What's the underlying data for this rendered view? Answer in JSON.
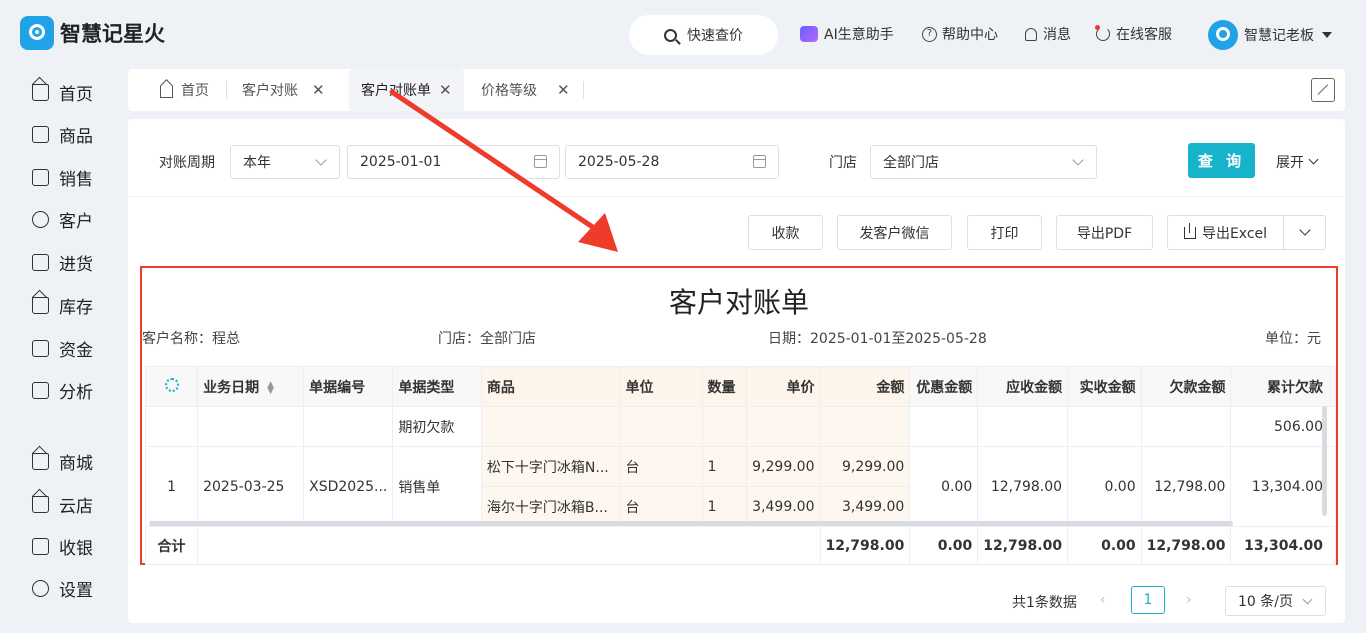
{
  "app": {
    "name": "智慧记星火"
  },
  "header": {
    "quick_search": "快速查价",
    "ai_assistant": "AI生意助手",
    "help_center": "帮助中心",
    "messages": "消息",
    "online_service": "在线客服",
    "user_name": "智慧记老板"
  },
  "sidebar": {
    "items": [
      {
        "label": "首页",
        "icon": "home-icon"
      },
      {
        "label": "商品",
        "icon": "bag-icon"
      },
      {
        "label": "销售",
        "icon": "clipboard-icon"
      },
      {
        "label": "客户",
        "icon": "user-icon"
      },
      {
        "label": "进货",
        "icon": "book-icon"
      },
      {
        "label": "库存",
        "icon": "warehouse-icon"
      },
      {
        "label": "资金",
        "icon": "wallet-icon"
      },
      {
        "label": "分析",
        "icon": "chart-icon"
      },
      {
        "label": "商城",
        "icon": "shop-icon"
      },
      {
        "label": "云店",
        "icon": "cloud-store-icon"
      },
      {
        "label": "收银",
        "icon": "cashier-icon"
      },
      {
        "label": "设置",
        "icon": "gear-icon"
      }
    ]
  },
  "tabs": [
    {
      "label": "首页"
    },
    {
      "label": "客户对账"
    },
    {
      "label": "客户对账单"
    },
    {
      "label": "价格等级"
    }
  ],
  "filters": {
    "period_label": "对账周期",
    "period_value": "本年",
    "start_date": "2025-01-01",
    "end_date": "2025-05-28",
    "store_label": "门店",
    "store_value": "全部门店",
    "query": "查 询",
    "expand": "展开"
  },
  "actions": {
    "receive": "收款",
    "send_wechat": "发客户微信",
    "print": "打印",
    "export_pdf": "导出PDF",
    "export_excel": "导出Excel"
  },
  "statement": {
    "title": "客户对账单",
    "customer": "客户名称：程总",
    "store": "门店：全部门店",
    "date": "日期：2025-01-01至2025-05-28",
    "unit": "单位：元",
    "columns": [
      "业务日期",
      "单据编号",
      "单据类型",
      "商品",
      "单位",
      "数量",
      "单价",
      "金额",
      "优惠金额",
      "应收金额",
      "实收金额",
      "欠款金额",
      "累计欠款"
    ],
    "opening": {
      "type": "期初欠款",
      "cumulative": "506.00"
    },
    "row": {
      "index": "1",
      "date": "2025-03-25",
      "doc_no": "XSD2025...",
      "type": "销售单",
      "discount": "0.00",
      "receivable": "12,798.00",
      "received": "0.00",
      "debt": "12,798.00",
      "cumulative": "13,304.00",
      "items": [
        {
          "product": "松下十字门冰箱N...",
          "unit": "台",
          "qty": "1",
          "price": "9,299.00",
          "amount": "9,299.00"
        },
        {
          "product": "海尔十字门冰箱B...",
          "unit": "台",
          "qty": "1",
          "price": "3,499.00",
          "amount": "3,499.00"
        }
      ]
    },
    "total": {
      "label": "合计",
      "amount": "12,798.00",
      "discount": "0.00",
      "receivable": "12,798.00",
      "received": "0.00",
      "debt": "12,798.00",
      "cumulative": "13,304.00"
    }
  },
  "pagination": {
    "total": "共1条数据",
    "page": "1",
    "page_size": "10 条/页"
  },
  "colors": {
    "accent": "#17b3cb",
    "highlight": "#ee3b2a",
    "total_red": "#ff5722"
  }
}
